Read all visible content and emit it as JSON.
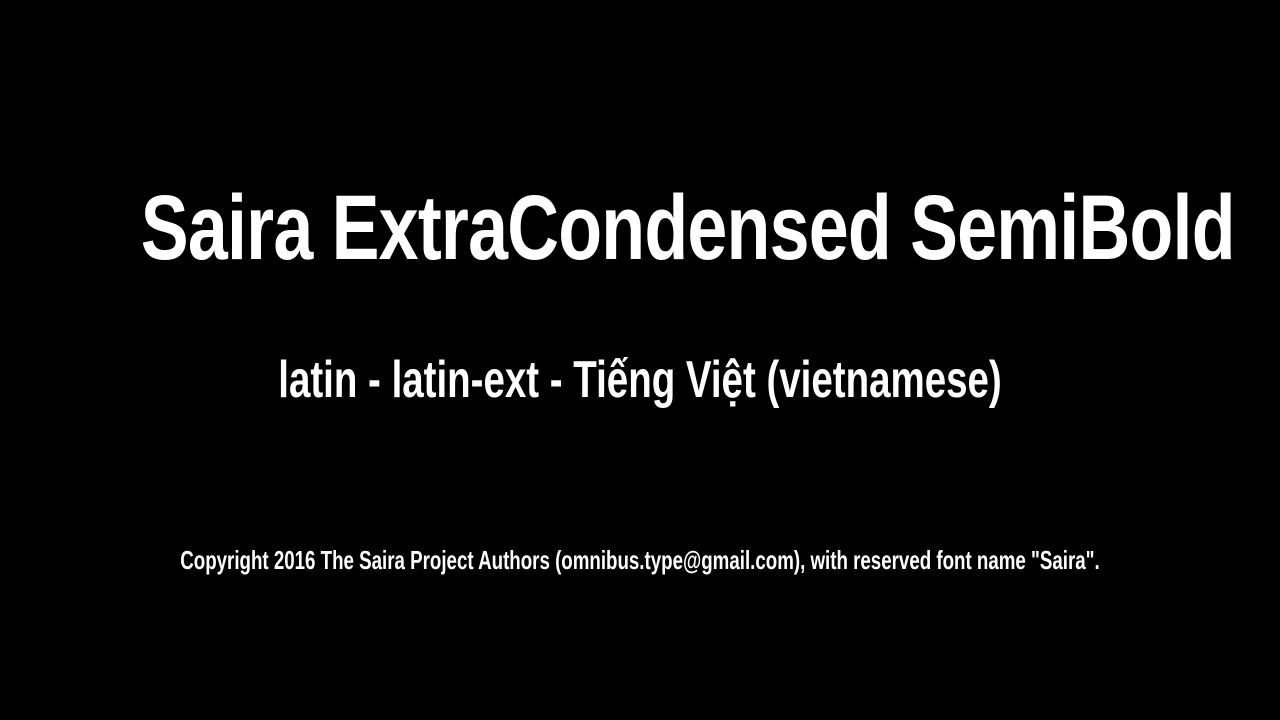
{
  "font_preview": {
    "title": "Saira ExtraCondensed SemiBold",
    "subsets": "latin - latin-ext - Tiếng Việt (vietnamese)",
    "copyright": "Copyright 2016 The Saira Project Authors (omnibus.type@gmail.com), with reserved font name \"Saira\"."
  },
  "colors": {
    "background": "#000000",
    "text": "#ffffff"
  }
}
